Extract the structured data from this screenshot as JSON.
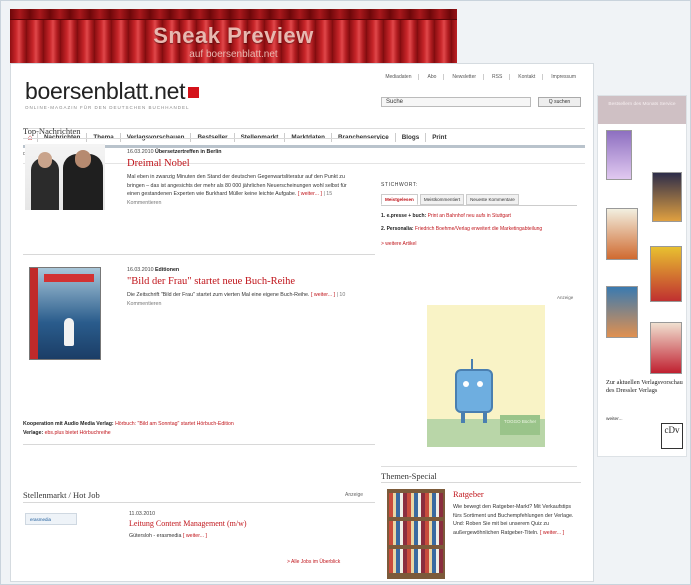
{
  "banner": {
    "title": "Sneak Preview",
    "subtitle": "auf boersenblatt.net"
  },
  "site": {
    "logo": "boersenblatt.net",
    "tagline": "ONLINE-MAGAZIN FÜR DEN DEUTSCHEN BUCHHANDEL"
  },
  "toplinks": [
    "Mediadaten",
    "Abo",
    "Newsletter",
    "RSS",
    "Kontakt",
    "Impressum"
  ],
  "search": {
    "value": "Suche",
    "button": "Q suchen"
  },
  "nav": [
    "Nachrichten",
    "Thema",
    "Verlagsvorschauen",
    "Bestseller",
    "Stellenmarkt",
    "Marktdaten",
    "Branchenservice",
    "Blogs",
    "Print"
  ],
  "datebar": "Dienstag, 16. März 2010 | 14:48 Uhr",
  "topnews": {
    "title": "Top-Nachrichten",
    "articles": [
      {
        "date": "16.03.2010",
        "category": "Übersetzertreffen in Berlin",
        "headline": "Dreimal Nobel",
        "body": "Mal eben in zwanzig Minuten den Stand der deutschen Gegenwartsliteratur auf den Punkt zu bringen – das ist angesichts der mehr als 80 000 jährlichen Neuerscheinungen wohl selbst für einen gestandenen Experten wie Burkhard Müller keine leichte Aufgabe.",
        "more": "[ weiter... ]",
        "comments": "| 15 Kommentieren"
      },
      {
        "date": "16.03.2010",
        "category": "Editionen",
        "headline": "\"Bild der Frau\" startet neue Buch-Reihe",
        "body": "Die Zeitschrift \"Bild der Frau\" startet zum vierten Mal eine eigene Buch-Reihe.",
        "more": "[ weiter... ]",
        "comments": "| 10 Kommentieren"
      }
    ]
  },
  "kooperation": {
    "label1": "Kooperation mit Audio Media Verlag:",
    "text1": "Hörbuch: \"Bild am Sonntag\" startet Hörbuch-Edition",
    "label2": "Verlage:",
    "text2": "ebs.plus bietet Hörbuchreihe"
  },
  "stellen": {
    "title": "Stellenmarkt / Hot Job",
    "anzeige": "Anzeige",
    "logo": "erasmedia",
    "date": "11.03.2010",
    "headline": "Leitung Content Management (m/w)",
    "company": "Gütersloh - erasmedia",
    "more": "[ weiter... ]",
    "all": "> Alle Jobs im Überblick"
  },
  "stichwort": {
    "label": "STICHWORT:",
    "tabs": [
      "Meistgelesen",
      "Meistkommentiert",
      "Neueste Kommentare"
    ],
    "items": [
      {
        "n": "1.",
        "name": "e.presse + buch:",
        "text": "Print an Bahnhof neu aufs in Stuttgart"
      },
      {
        "n": "2.",
        "name": "Personalia:",
        "text": "Friedrich Boehme/Verlag erweitert die Marketingabteilung"
      }
    ],
    "more": "> weitere Artikel"
  },
  "ad": {
    "anzeige": "Anzeige",
    "tag": "TOGGO Bücher"
  },
  "themen": {
    "title": "Themen-Special",
    "headline": "Ratgeber",
    "body": "Wie bewegt den Ratgeber-Markt? Mit Verkaufstips fürs Sortiment und Buchempfehlungen der Verlage. Und: Roben Sie mit bei unserem Quiz zu außergewöhnlichen Ratgeber-Titeln.",
    "more": "[ weiter... ]"
  },
  "sidebar": {
    "head": "Bestsellern des Monats Service",
    "text": "Zur aktuellen Verlagsvorschau des Dressler Verlags",
    "more": "weiter...",
    "logo": "cDv"
  }
}
